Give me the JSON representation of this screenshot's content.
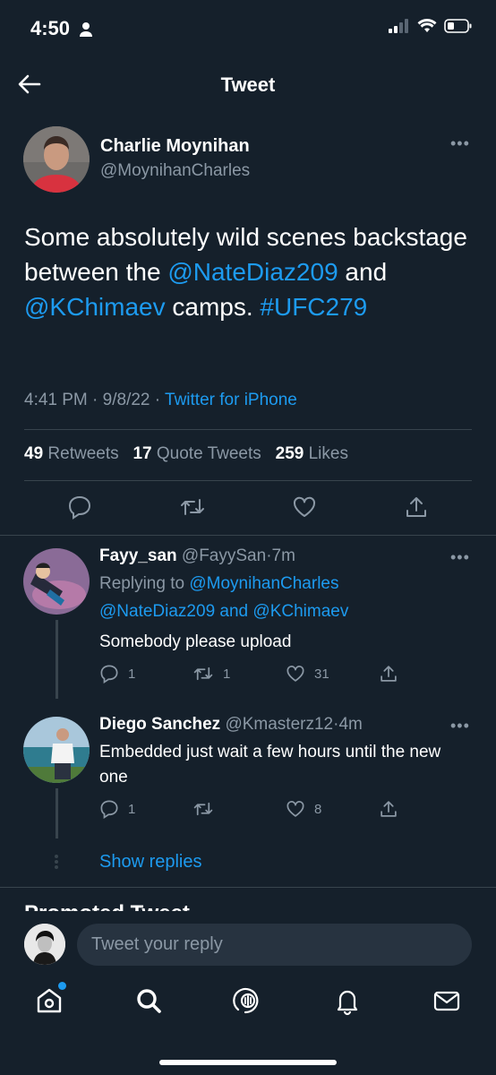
{
  "status_bar": {
    "time": "4:50"
  },
  "header": {
    "title": "Tweet"
  },
  "main_tweet": {
    "name": "Charlie Moynihan",
    "handle": "@MoynihanCharles",
    "text": {
      "part1": "Some absolutely wild scenes backstage between the ",
      "mention1": "@NateDiaz209",
      "and": " and ",
      "mention2": "@KChimaev",
      "part2": " camps. ",
      "hashtag": "#UFC279"
    },
    "time": "4:41 PM",
    "date": "9/8/22",
    "sep": " · ",
    "source": "Twitter for iPhone",
    "stats": {
      "retweets": "49",
      "retweets_label": "Retweets",
      "quotes": "17",
      "quotes_label": "Quote Tweets",
      "likes": "259",
      "likes_label": "Likes"
    }
  },
  "replies": [
    {
      "name": "Fayy_san",
      "handle": "@FayySan",
      "time": "7m",
      "replying_to_label": "Replying to ",
      "replying_to_user": "@MoynihanCharles",
      "replying_to_line2a": "@NateDiaz209",
      "replying_to_and": " and ",
      "replying_to_line2b": "@KChimaev",
      "text": "Somebody please upload",
      "replies": "1",
      "retweets": "1",
      "likes": "31"
    },
    {
      "name": "Diego Sanchez",
      "handle": "@Kmasterz12",
      "time": "4m",
      "text": "Embedded just wait a few hours until the new one",
      "replies": "1",
      "retweets": "",
      "likes": "8"
    }
  ],
  "show_replies": "Show replies",
  "promoted_label": "Promoted Tweet",
  "compose": {
    "placeholder": "Tweet your reply"
  },
  "colors": {
    "background": "#15202b",
    "accent": "#1d9bf0",
    "secondary_text": "#8b98a5",
    "divider": "#38444d"
  }
}
